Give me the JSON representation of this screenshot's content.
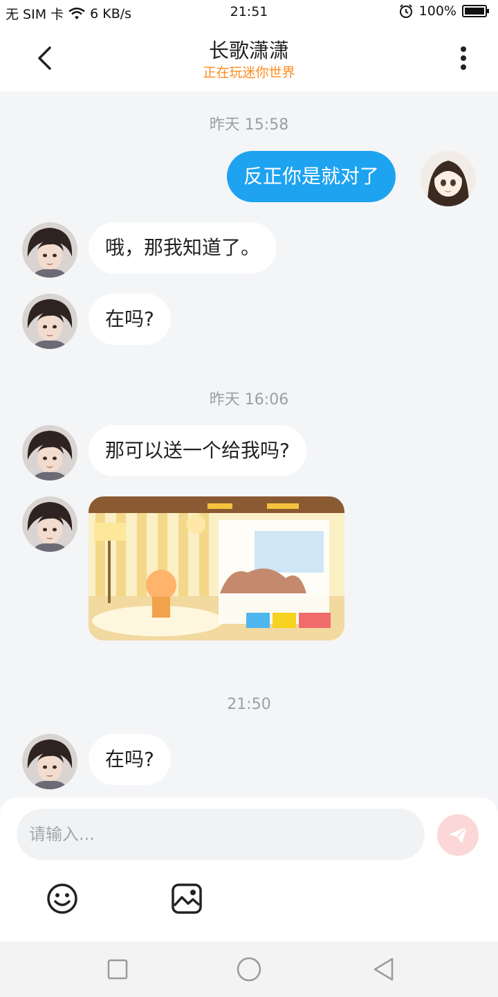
{
  "status": {
    "carrier": "无 SIM 卡",
    "net_speed": "6 KB/s",
    "time": "21:51",
    "battery": "100%"
  },
  "header": {
    "title": "长歌潇潇",
    "subtitle": "正在玩迷你世界"
  },
  "chat": {
    "timestamps": [
      "昨天 15:58",
      "昨天 16:06",
      "21:50"
    ],
    "messages": [
      {
        "side": "out",
        "text": "反正你是就对了"
      },
      {
        "side": "in",
        "text": "哦，那我知道了。"
      },
      {
        "side": "in",
        "text": "在吗?"
      },
      {
        "side": "in",
        "text": "那可以送一个给我吗?"
      },
      {
        "side": "in",
        "type": "image"
      },
      {
        "side": "in",
        "text": "在吗?"
      }
    ]
  },
  "input": {
    "placeholder": "请输入..."
  },
  "icons": {
    "back": "chevron-left-icon",
    "more": "more-vertical-icon",
    "send": "send-icon",
    "emoji": "emoji-icon",
    "image": "image-icon"
  },
  "colors": {
    "accent_orange": "#ff8a1d",
    "bubble_out": "#1ea3f0",
    "send_disabled": "#fbd7d7"
  }
}
